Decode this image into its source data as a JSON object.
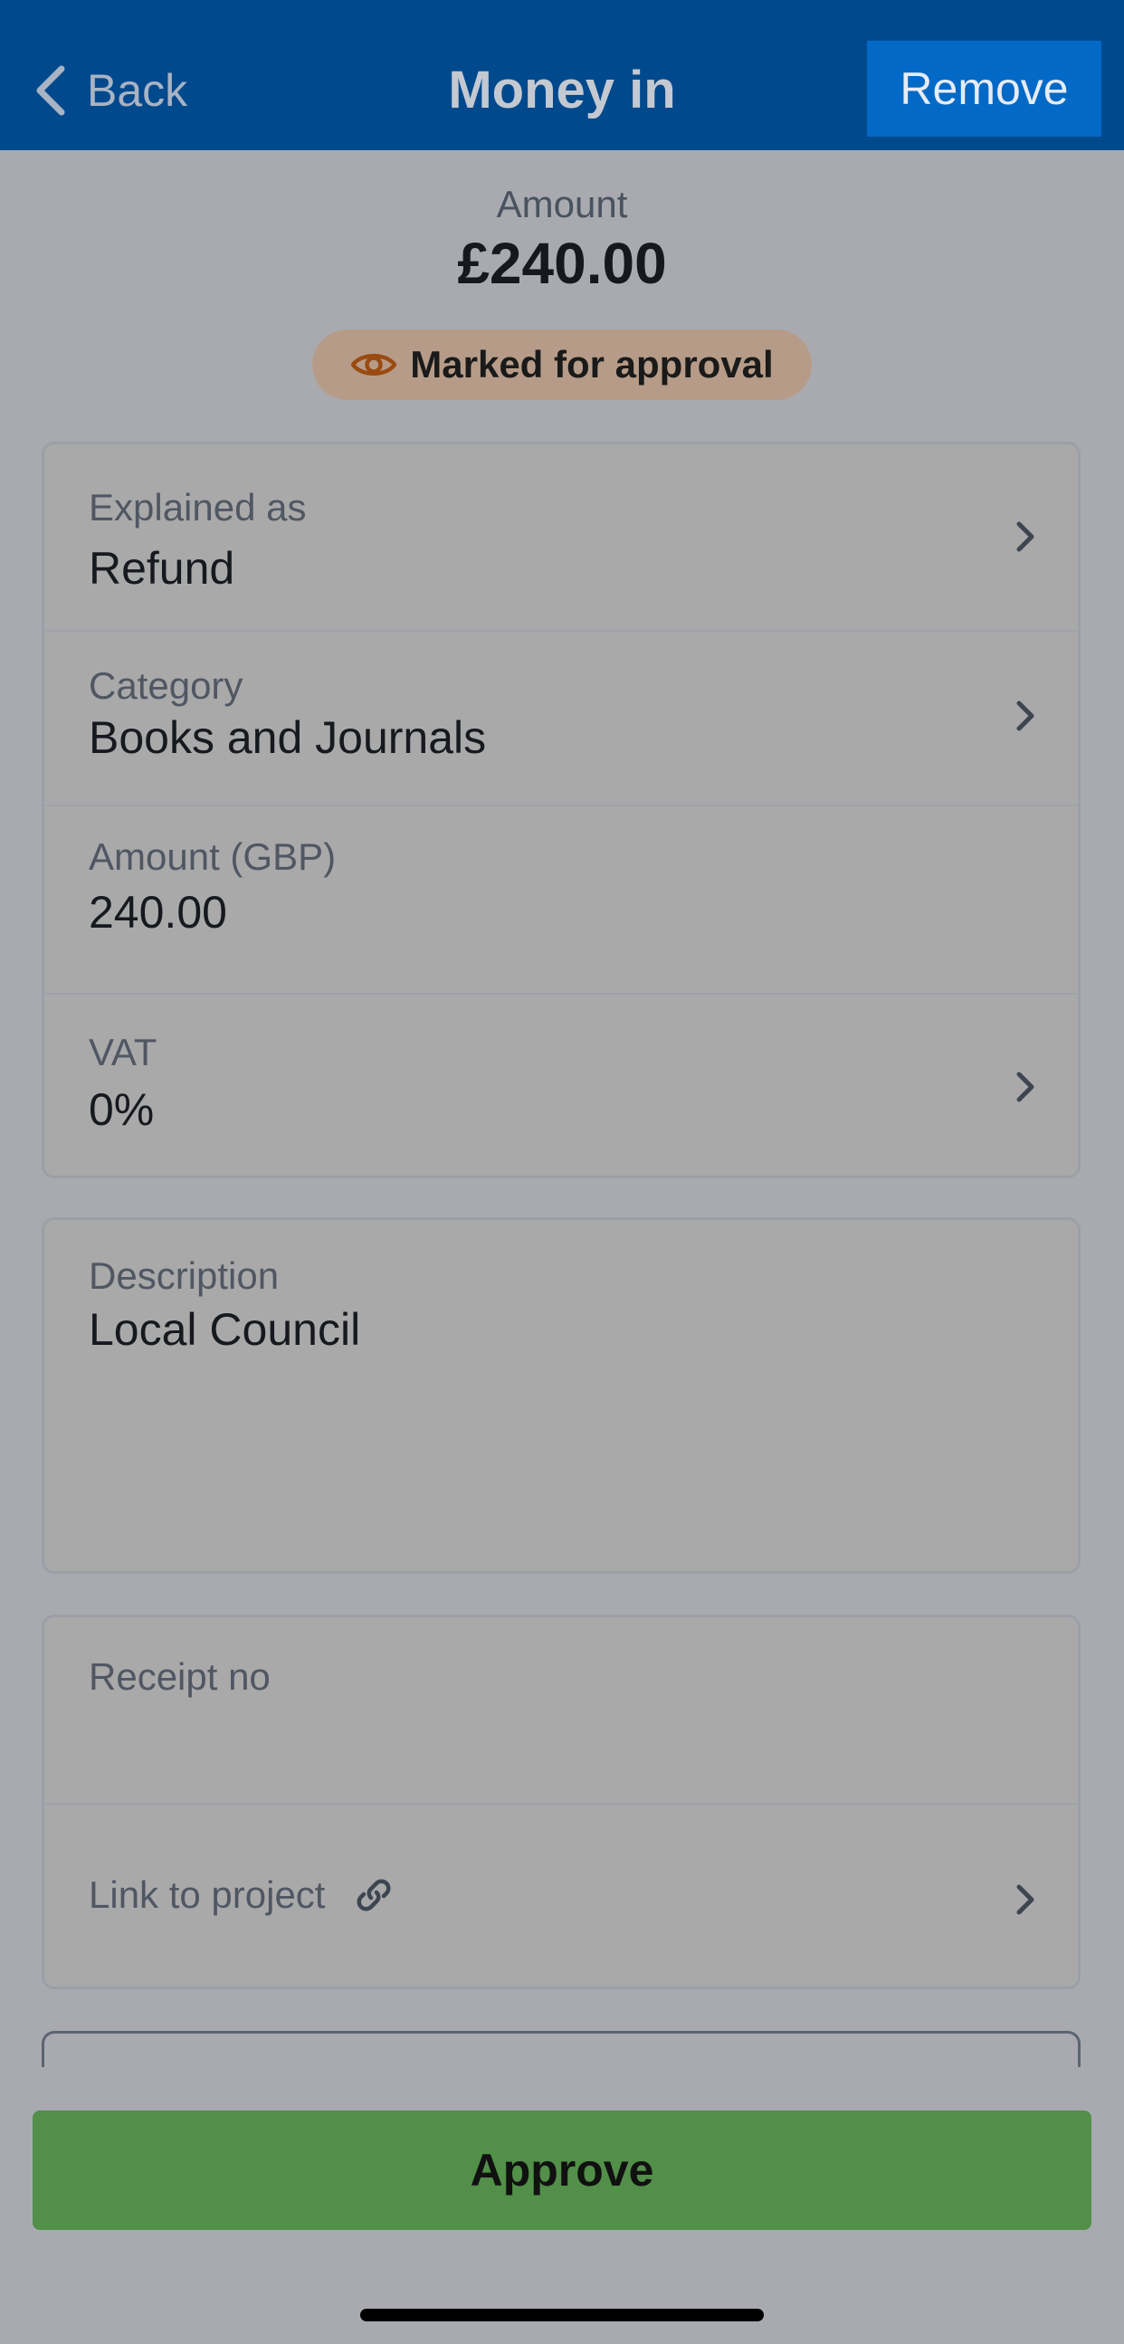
{
  "header": {
    "back_label": "Back",
    "title": "Money in",
    "remove_label": "Remove"
  },
  "summary": {
    "amount_label": "Amount",
    "amount_value": "£240.00",
    "status": "Marked for approval"
  },
  "details": {
    "explained_as": {
      "label": "Explained as",
      "value": "Refund"
    },
    "category": {
      "label": "Category",
      "value": "Books and Journals"
    },
    "amount": {
      "label": "Amount (GBP)",
      "value": "240.00"
    },
    "vat": {
      "label": "VAT",
      "value": "0%"
    }
  },
  "description": {
    "label": "Description",
    "value": "Local Council"
  },
  "extra": {
    "receipt_label": "Receipt no",
    "receipt_value": "",
    "link_project_label": "Link to project"
  },
  "actions": {
    "approve_label": "Approve"
  },
  "colors": {
    "nav_bg": "#01498d",
    "remove_bg": "#0369c6",
    "approve_bg": "#528f49",
    "badge_bg": "#b69c88",
    "badge_icon": "#9a4b12"
  },
  "icons": {
    "back": "chevron-left-icon",
    "status": "eye-icon",
    "row_chevron": "chevron-right-icon",
    "link": "link-icon"
  }
}
